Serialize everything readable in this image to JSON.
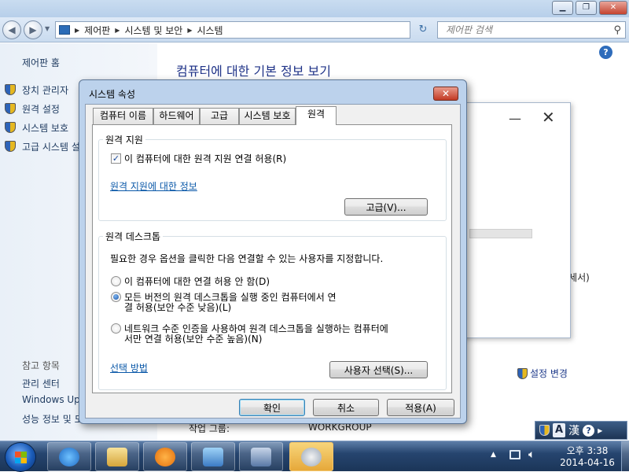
{
  "explorer": {
    "nav": {
      "breadcrumb": [
        "제어판",
        "시스템 및 보안",
        "시스템"
      ],
      "search_placeholder": "제어판 검색"
    },
    "sidebar": {
      "home": "제어판 홈",
      "items": [
        {
          "label": "장치 관리자"
        },
        {
          "label": "원격 설정"
        },
        {
          "label": "시스템 보호"
        },
        {
          "label": "고급 시스템 설정"
        }
      ],
      "see_also_heading": "참고 항목",
      "see_also": [
        "관리 센터",
        "Windows Update",
        "성능 정보 및 도구"
      ]
    },
    "main": {
      "title": "컴퓨터에 대한 기본 정보 보기",
      "settings_change": "설정 변경",
      "processor_fragment": "로세서)",
      "workgroup_label_fragment": "작업 그룹:",
      "workgroup_value": "WORKGROUP"
    }
  },
  "dialog": {
    "title": "시스템 속성",
    "close_glyph": "✕",
    "tabs": [
      "컴퓨터 이름",
      "하드웨어",
      "고급",
      "시스템 보호",
      "원격"
    ],
    "active_tab": "원격",
    "remote_assistance": {
      "legend": "원격 지원",
      "checkbox_label": "이 컴퓨터에 대한 원격 지원 연결 허용(R)",
      "checkbox_checked": true,
      "info_link": "원격 지원에 대한 정보",
      "advanced_button": "고급(V)..."
    },
    "remote_desktop": {
      "legend": "원격 데스크톱",
      "description": "필요한 경우 옵션을 클릭한 다음 연결할 수 있는 사용자를 지정합니다.",
      "options": [
        {
          "line1": "이 컴퓨터에 대한 연결 허용 안 함(D)",
          "line2": "",
          "selected": false
        },
        {
          "line1": "모든 버전의 원격 데스크톱을 실행 중인 컴퓨터에서 연",
          "line2": "결 허용(보안 수준 낮음)(L)",
          "selected": true
        },
        {
          "line1": "네트워크 수준 인증을 사용하여 원격 데스크톱을 실행하는 컴퓨터에",
          "line2": "서만 연결 허용(보안 수준 높음)(N)",
          "selected": false
        }
      ],
      "help_link": "선택 방법",
      "select_users_button": "사용자 선택(S)..."
    },
    "buttons": {
      "ok": "확인",
      "cancel": "취소",
      "apply": "적용(A)"
    }
  },
  "taskbar": {
    "language": {
      "mode": "A",
      "hanja": "漢",
      "help": "?"
    },
    "clock": {
      "time": "오후 3:38",
      "date": "2014-04-16"
    }
  }
}
